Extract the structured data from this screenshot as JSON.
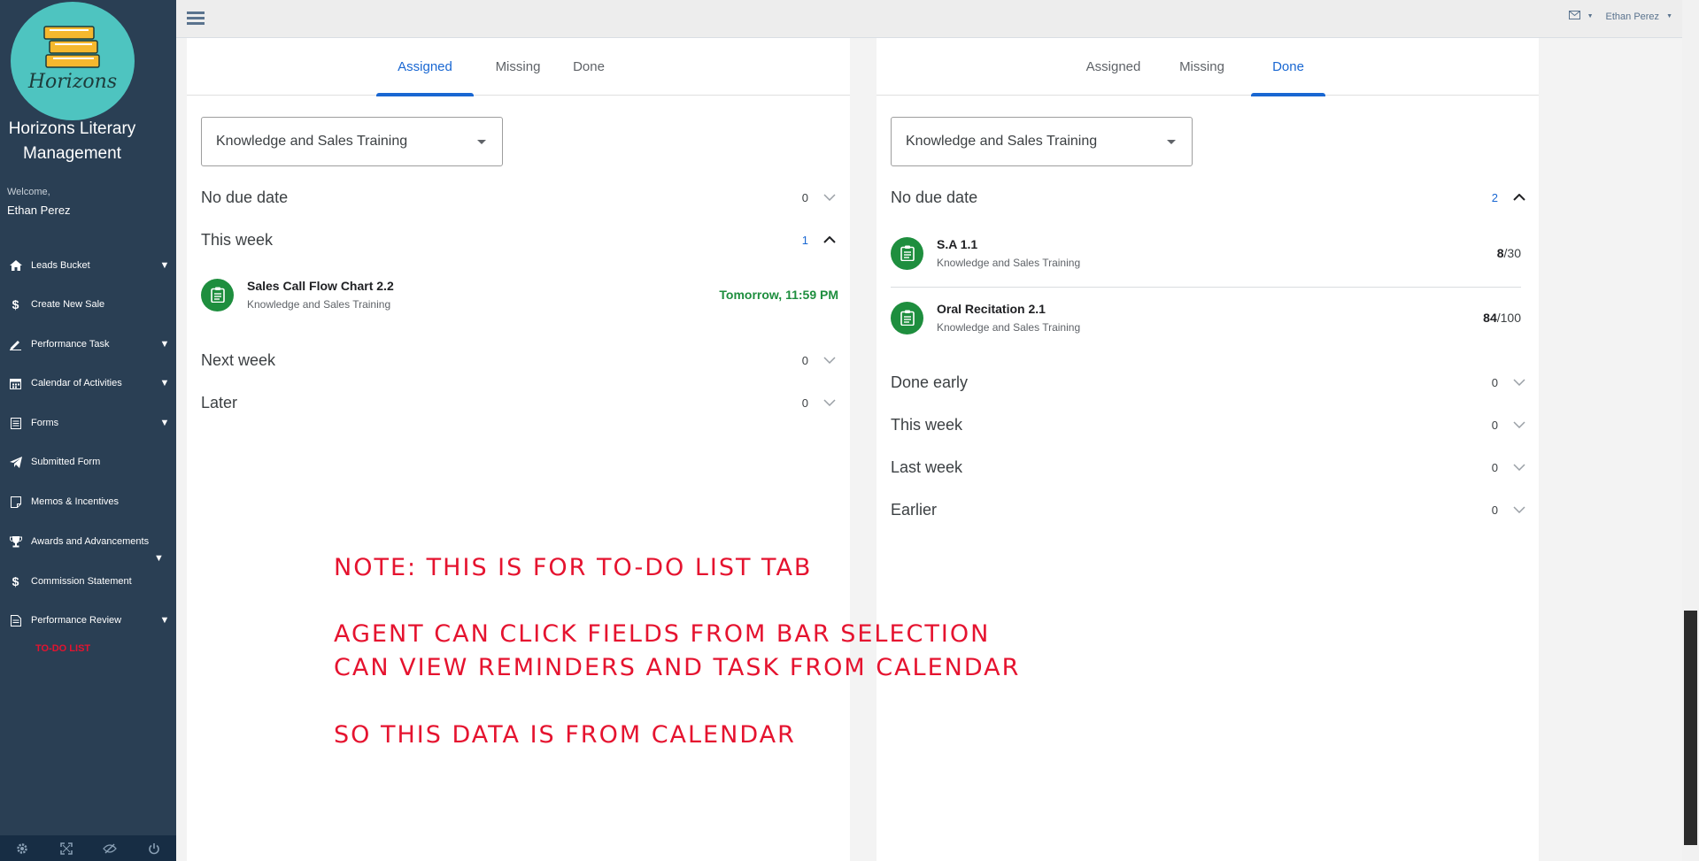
{
  "sidebar": {
    "logo_text": "Horizons",
    "brand_line1": "Horizons Literary",
    "brand_line2": "Management",
    "welcome": "Welcome,",
    "username": "Ethan Perez",
    "items": [
      {
        "label": "Leads Bucket",
        "icon": "home-icon",
        "caret": true
      },
      {
        "label": "Create New Sale",
        "icon": "dollar-icon",
        "caret": false
      },
      {
        "label": "Performance Task",
        "icon": "pen-icon",
        "caret": true
      },
      {
        "label": "Calendar of Activities",
        "icon": "calendar-icon",
        "caret": true
      },
      {
        "label": "Forms",
        "icon": "form-icon",
        "caret": true
      },
      {
        "label": "Submitted Form",
        "icon": "paper-plane-icon",
        "caret": false
      },
      {
        "label": "Memos & Incentives",
        "icon": "memo-icon",
        "caret": false
      },
      {
        "label": "Awards and Advancements",
        "icon": "trophy-icon",
        "caret": true
      },
      {
        "label": "Commission Statement",
        "icon": "dollar-icon",
        "caret": false
      },
      {
        "label": "Performance Review",
        "icon": "document-icon",
        "caret": true
      }
    ],
    "todo_label": "TO-DO LIST"
  },
  "topbar": {
    "user_name": "Ethan Perez"
  },
  "left_panel": {
    "tabs": [
      "Assigned",
      "Missing",
      "Done"
    ],
    "active_tab": "Assigned",
    "class_select": "Knowledge and Sales Training",
    "sections": [
      {
        "title": "No due date",
        "count": "0",
        "expanded": false
      },
      {
        "title": "This week",
        "count": "1",
        "expanded": true
      },
      {
        "title": "Next week",
        "count": "0",
        "expanded": false
      },
      {
        "title": "Later",
        "count": "0",
        "expanded": false
      }
    ],
    "items": [
      {
        "title": "Sales Call Flow Chart 2.2",
        "subtitle": "Knowledge and Sales Training",
        "due": "Tomorrow, 11:59 PM"
      }
    ]
  },
  "right_panel": {
    "tabs": [
      "Assigned",
      "Missing",
      "Done"
    ],
    "active_tab": "Done",
    "class_select": "Knowledge and Sales Training",
    "sections": [
      {
        "title": "No due date",
        "count": "2",
        "expanded": true
      },
      {
        "title": "Done early",
        "count": "0",
        "expanded": false
      },
      {
        "title": "This week",
        "count": "0",
        "expanded": false
      },
      {
        "title": "Last week",
        "count": "0",
        "expanded": false
      },
      {
        "title": "Earlier",
        "count": "0",
        "expanded": false
      }
    ],
    "items": [
      {
        "title": "S.A 1.1",
        "subtitle": "Knowledge and Sales Training",
        "score": "8",
        "total": "/30"
      },
      {
        "title": "Oral Recitation 2.1",
        "subtitle": "Knowledge and Sales Training",
        "score": "84",
        "total": "/100"
      }
    ]
  },
  "note": {
    "line1": "NOTE: THIS IS FOR TO-DO LIST TAB",
    "line2": "AGENT CAN CLICK FIELDS FROM BAR SELECTION",
    "line3": "CAN VIEW REMINDERS AND TASK FROM CALENDAR",
    "line4": "SO THIS DATA IS FROM CALENDAR"
  },
  "colors": {
    "sidebar_bg": "#2a3f54",
    "accent_blue": "#1967d2",
    "success_green": "#1e8e3e",
    "note_red": "#e5132f"
  }
}
